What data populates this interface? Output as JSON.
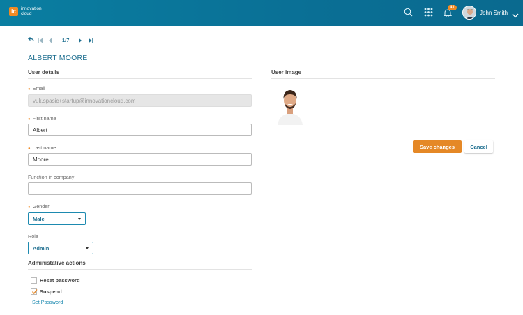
{
  "brand": {
    "mark": "ic",
    "line1": "innovation",
    "line2": "cloud",
    "accent": "#f08a24",
    "header_color": "#0a7ea1"
  },
  "header": {
    "notification_count": "41",
    "user_name": "John Smith"
  },
  "pager": {
    "position": "1/7"
  },
  "page": {
    "title": "ALBERT MOORE"
  },
  "user_details": {
    "section_title": "User details",
    "email": {
      "label": "Email",
      "value": "vuk.spasic+startup@innovationcloud.com"
    },
    "first_name": {
      "label": "First name",
      "value": "Albert"
    },
    "last_name": {
      "label": "Last name",
      "value": "Moore"
    },
    "function": {
      "label": "Function in company",
      "value": ""
    },
    "gender": {
      "label": "Gender",
      "value": "Male"
    },
    "role": {
      "label": "Role",
      "value": "Admin"
    }
  },
  "user_image": {
    "section_title": "User image"
  },
  "actions": {
    "save": "Save changes",
    "cancel": "Cancel"
  },
  "admin": {
    "section_title": "Administative actions",
    "reset_password": "Reset password",
    "suspend": "Suspend",
    "suspend_checked": true,
    "set_password": "Set Password"
  }
}
